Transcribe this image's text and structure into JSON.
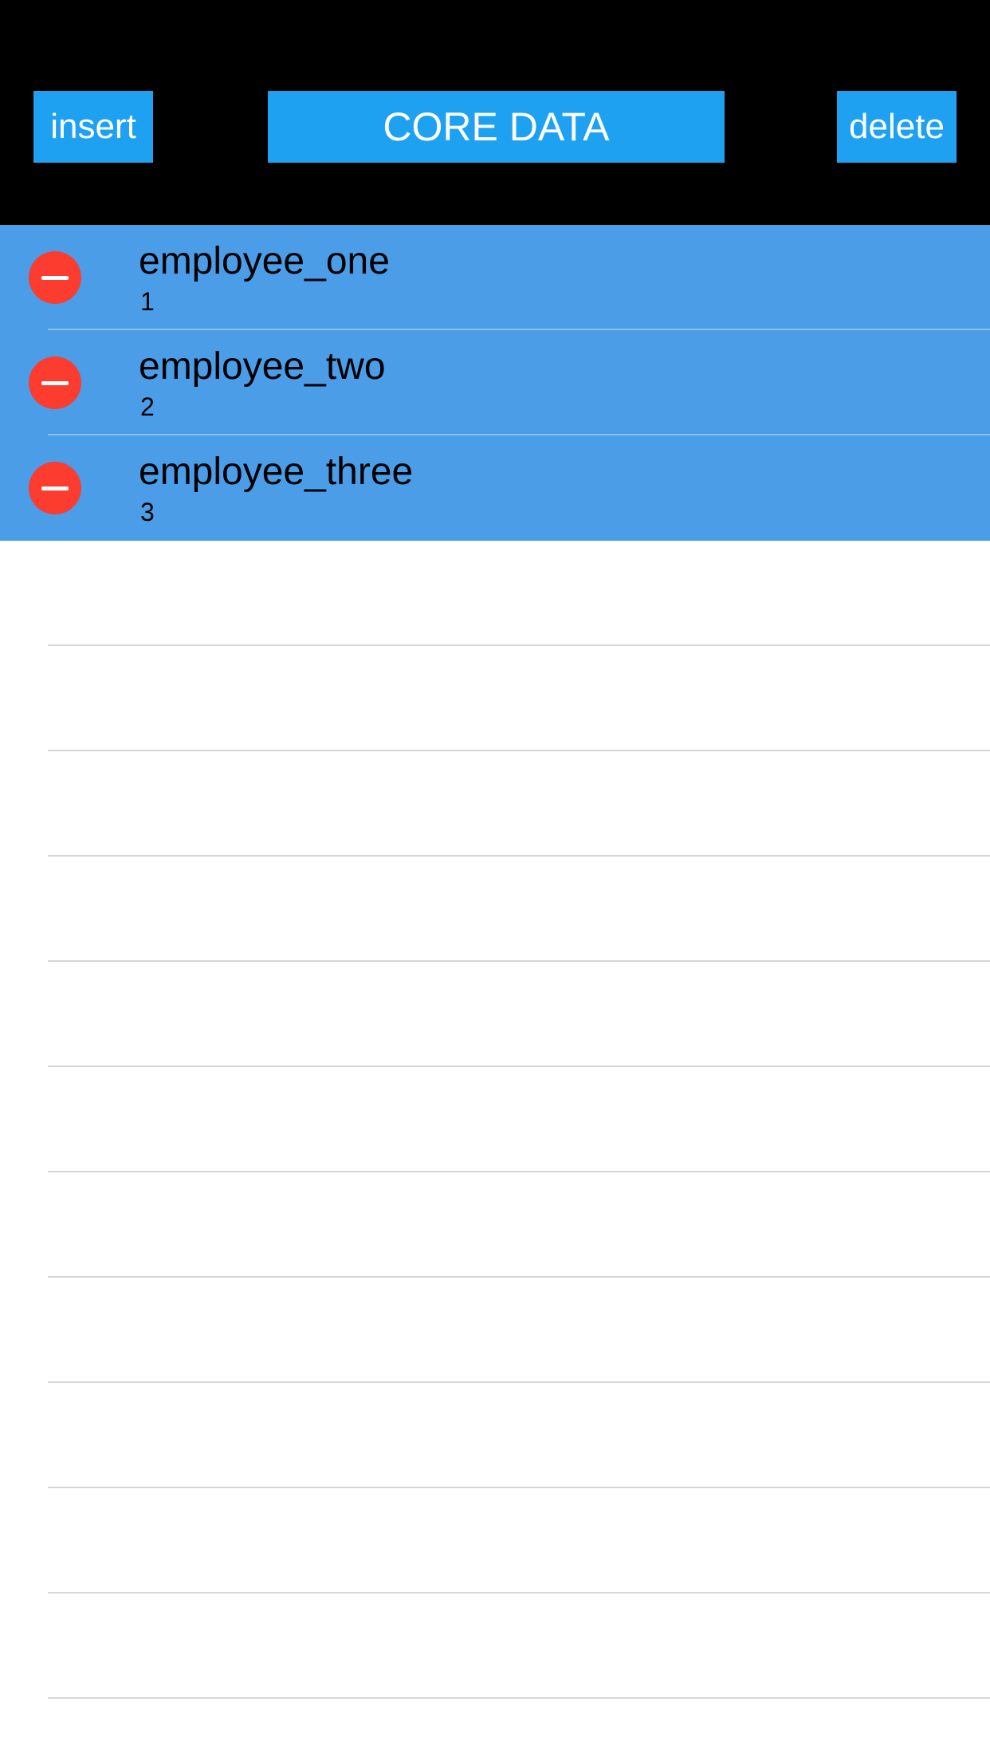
{
  "header": {
    "insert_label": "insert",
    "title": "CORE DATA",
    "delete_label": "delete"
  },
  "colors": {
    "header_background": "#000000",
    "button_background": "#1ea1f1",
    "row_background": "#4b9de8",
    "delete_control": "#fb3c2f"
  },
  "employees": [
    {
      "name": "employee_one",
      "id": "1"
    },
    {
      "name": "employee_two",
      "id": "2"
    },
    {
      "name": "employee_three",
      "id": "3"
    }
  ]
}
